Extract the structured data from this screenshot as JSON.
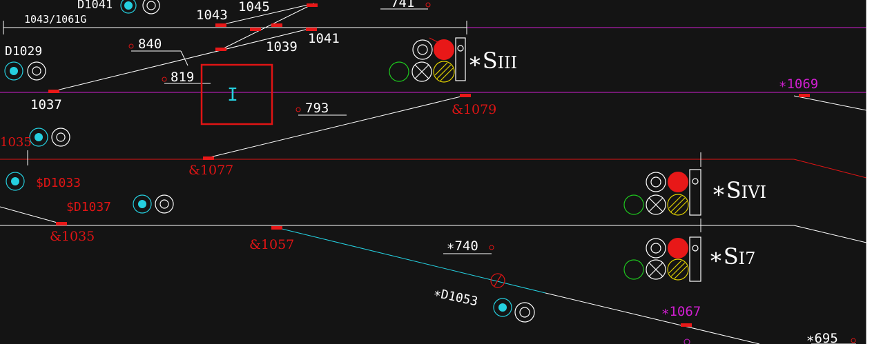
{
  "canvas": {
    "background": "#141414",
    "frame_background": "#ffffff"
  },
  "colors": {
    "white": "#ffffff",
    "magenta": "#d01ed0",
    "red": "#e01414",
    "cyan": "#25d0e0",
    "green": "#1ec81e",
    "yellow": "#e0d000",
    "signal_red": "#e81818"
  },
  "labels": {
    "d1041": "D1041",
    "d1041_sub": "1043/1061G",
    "n1043": "1043",
    "n1045": "1045",
    "n741": "741",
    "n1039": "1039",
    "n1041": "1041",
    "d1029": "D1029",
    "n840": "840",
    "n819": "819",
    "n1037": "1037",
    "n793": "793",
    "n1079": "&1079",
    "n1069": "∗1069",
    "s1035": "1035",
    "n1077": "&1077",
    "d1033": "$D1033",
    "d1037": "$D1037",
    "n1035": "&1035",
    "n1057": "&1057",
    "n740": "∗740",
    "d1053": "∗D1053",
    "n1067": "∗1067",
    "n695": "∗695"
  },
  "signals": {
    "siii": {
      "prefix": "∗S",
      "suffix": "III"
    },
    "sivi": {
      "prefix": "∗S",
      "suffix": "IVI"
    },
    "si7": {
      "prefix": "∗S",
      "suffix": "I7"
    }
  },
  "marker": {
    "label": "I"
  },
  "icons": [
    "signal-head-icon",
    "shunt-signal-icon",
    "track-circuit-marker-icon",
    "selection-box-icon"
  ]
}
